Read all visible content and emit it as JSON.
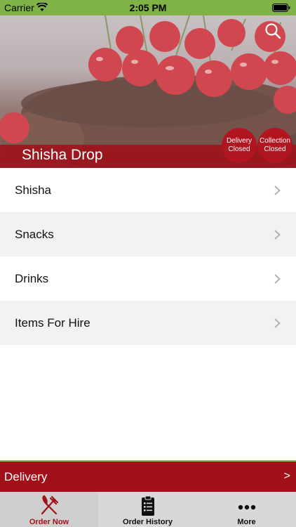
{
  "status_bar": {
    "carrier": "Carrier",
    "time": "2:05 PM"
  },
  "hero": {
    "title": "Shisha Drop",
    "badges": {
      "delivery": {
        "line1": "Delivery",
        "line2": "Closed"
      },
      "collection": {
        "line1": "Collection",
        "line2": "Closed"
      }
    }
  },
  "categories": [
    {
      "label": "Shisha"
    },
    {
      "label": "Snacks"
    },
    {
      "label": "Drinks"
    },
    {
      "label": "Items For Hire"
    }
  ],
  "delivery_bar": {
    "label": "Delivery",
    "arrow": ">"
  },
  "tabs": [
    {
      "label": "Order Now",
      "icon": "fork-knife-icon"
    },
    {
      "label": "Order History",
      "icon": "clipboard-list-icon"
    },
    {
      "label": "More",
      "icon": "more-dots-icon"
    }
  ],
  "colors": {
    "brand_red": "#a1111a",
    "status_green": "#7fb347",
    "tab_bar": "#d8d8d8"
  }
}
